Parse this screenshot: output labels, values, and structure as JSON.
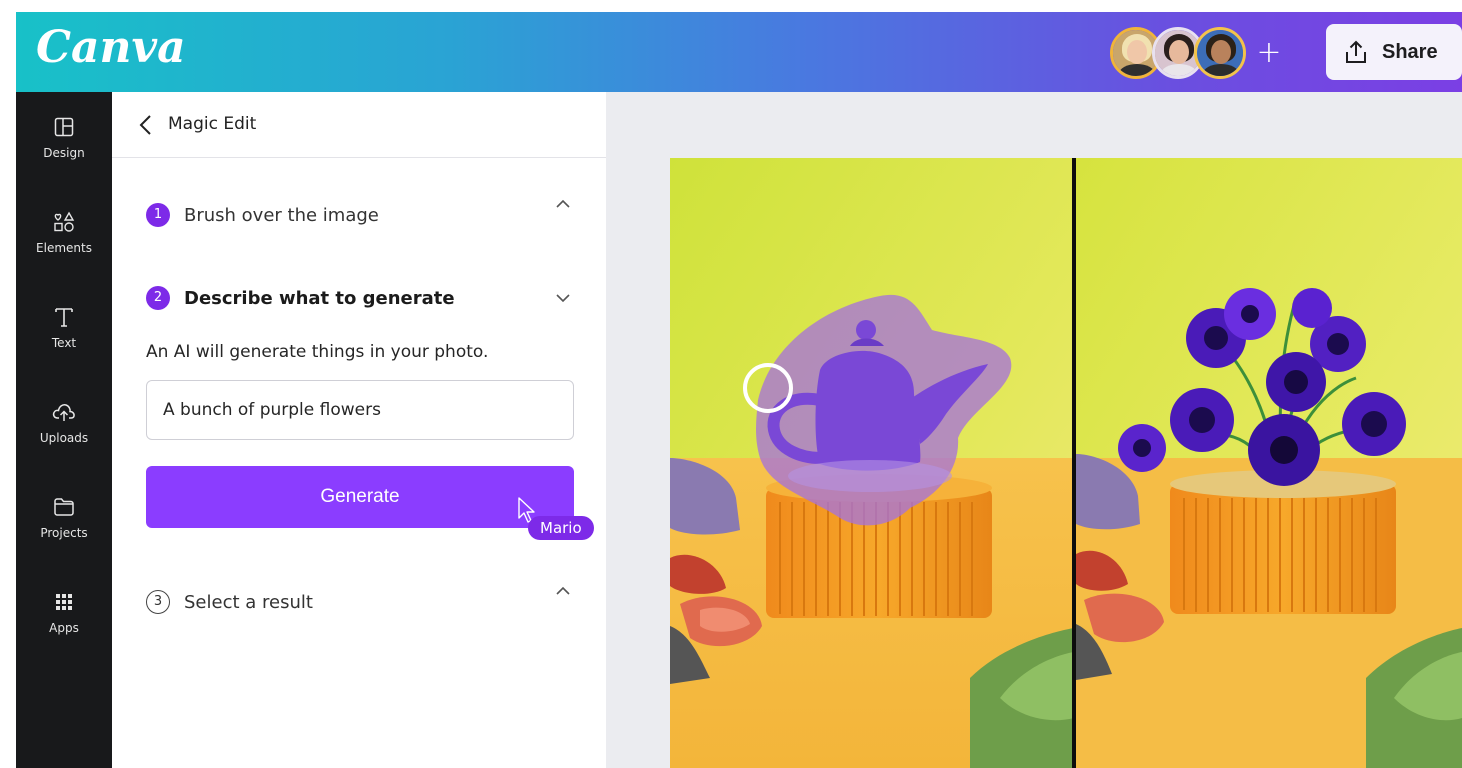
{
  "app": {
    "logo": "Canva",
    "share_label": "Share"
  },
  "header": {
    "collaborators": [
      "collaborator-1",
      "collaborator-2",
      "collaborator-3"
    ],
    "add_label": "+"
  },
  "sidebar": {
    "items": [
      {
        "label": "Design",
        "icon": "layout-icon"
      },
      {
        "label": "Elements",
        "icon": "shapes-icon"
      },
      {
        "label": "Text",
        "icon": "text-icon"
      },
      {
        "label": "Uploads",
        "icon": "cloud-upload-icon"
      },
      {
        "label": "Projects",
        "icon": "folder-icon"
      },
      {
        "label": "Apps",
        "icon": "grid-icon"
      }
    ]
  },
  "panel": {
    "title": "Magic Edit",
    "steps": [
      {
        "number": "1",
        "label": "Brush over the image"
      },
      {
        "number": "2",
        "label": "Describe what to generate"
      },
      {
        "number": "3",
        "label": "Select a result"
      }
    ],
    "description": "An AI will generate things in your photo.",
    "prompt_value": "A bunch of purple flowers",
    "generate_label": "Generate",
    "cursor_name": "Mario"
  },
  "colors": {
    "accent": "#8b3dff",
    "step_badge": "#7d2ae8",
    "rail": "#18191b",
    "canvas": "#ebecf0"
  }
}
